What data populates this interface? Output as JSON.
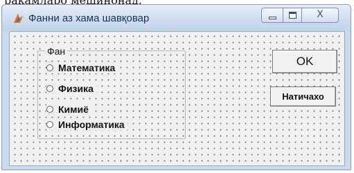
{
  "page_caption": "рақамларо мешинонад.",
  "window": {
    "title": "Фанни аз хама шавқовар",
    "controls": {
      "close_glyph": "X",
      "minimize_icon": "minimize-icon",
      "maximize_icon": "maximize-icon"
    },
    "colors": {
      "title_text": "#1a2f5c",
      "frame": "#c9d9ee",
      "client": "#f0f0f0"
    }
  },
  "form": {
    "group_label": "Фан",
    "options": [
      {
        "label": "Математика",
        "selected": false
      },
      {
        "label": "Физика",
        "selected": false
      },
      {
        "label": "Кимиё",
        "selected": false
      },
      {
        "label": "Информатика",
        "selected": false
      }
    ],
    "ok_label": "OK",
    "cancel_label": "Натичахо"
  }
}
